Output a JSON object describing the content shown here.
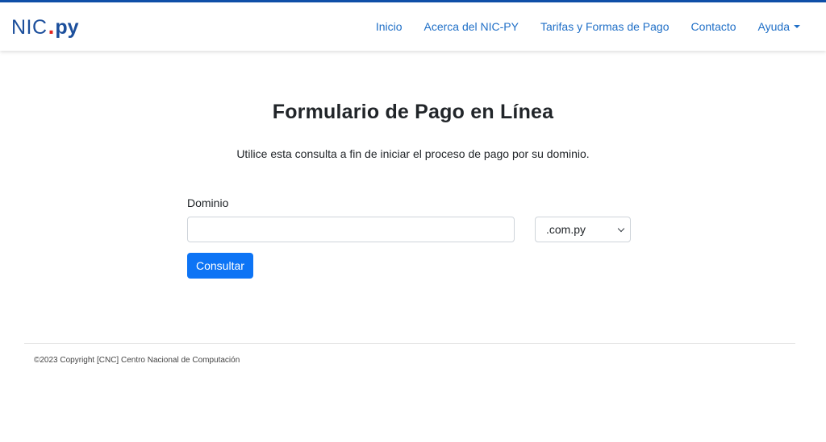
{
  "brand": {
    "nic": "NIC",
    "dot": ".",
    "py": "py"
  },
  "nav": {
    "items": [
      {
        "label": "Inicio"
      },
      {
        "label": "Acerca del NIC-PY"
      },
      {
        "label": "Tarifas y Formas de Pago"
      },
      {
        "label": "Contacto"
      },
      {
        "label": "Ayuda"
      }
    ]
  },
  "main": {
    "title": "Formulario de Pago en Línea",
    "subtitle": "Utilice esta consulta a fin de iniciar el proceso de pago por su dominio.",
    "form": {
      "domain_label": "Dominio",
      "domain_value": "",
      "domain_placeholder": "",
      "extension_selected": ".com.py",
      "submit_label": "Consultar"
    }
  },
  "footer": {
    "copyright": "©2023 Copyright [CNC] Centro Nacional de Computación"
  },
  "colors": {
    "accent": "#0f4fa8",
    "link": "#1f6fc7",
    "button": "#0d74f5",
    "brand_blue": "#1c4f9c",
    "brand_red": "#e2251e"
  }
}
